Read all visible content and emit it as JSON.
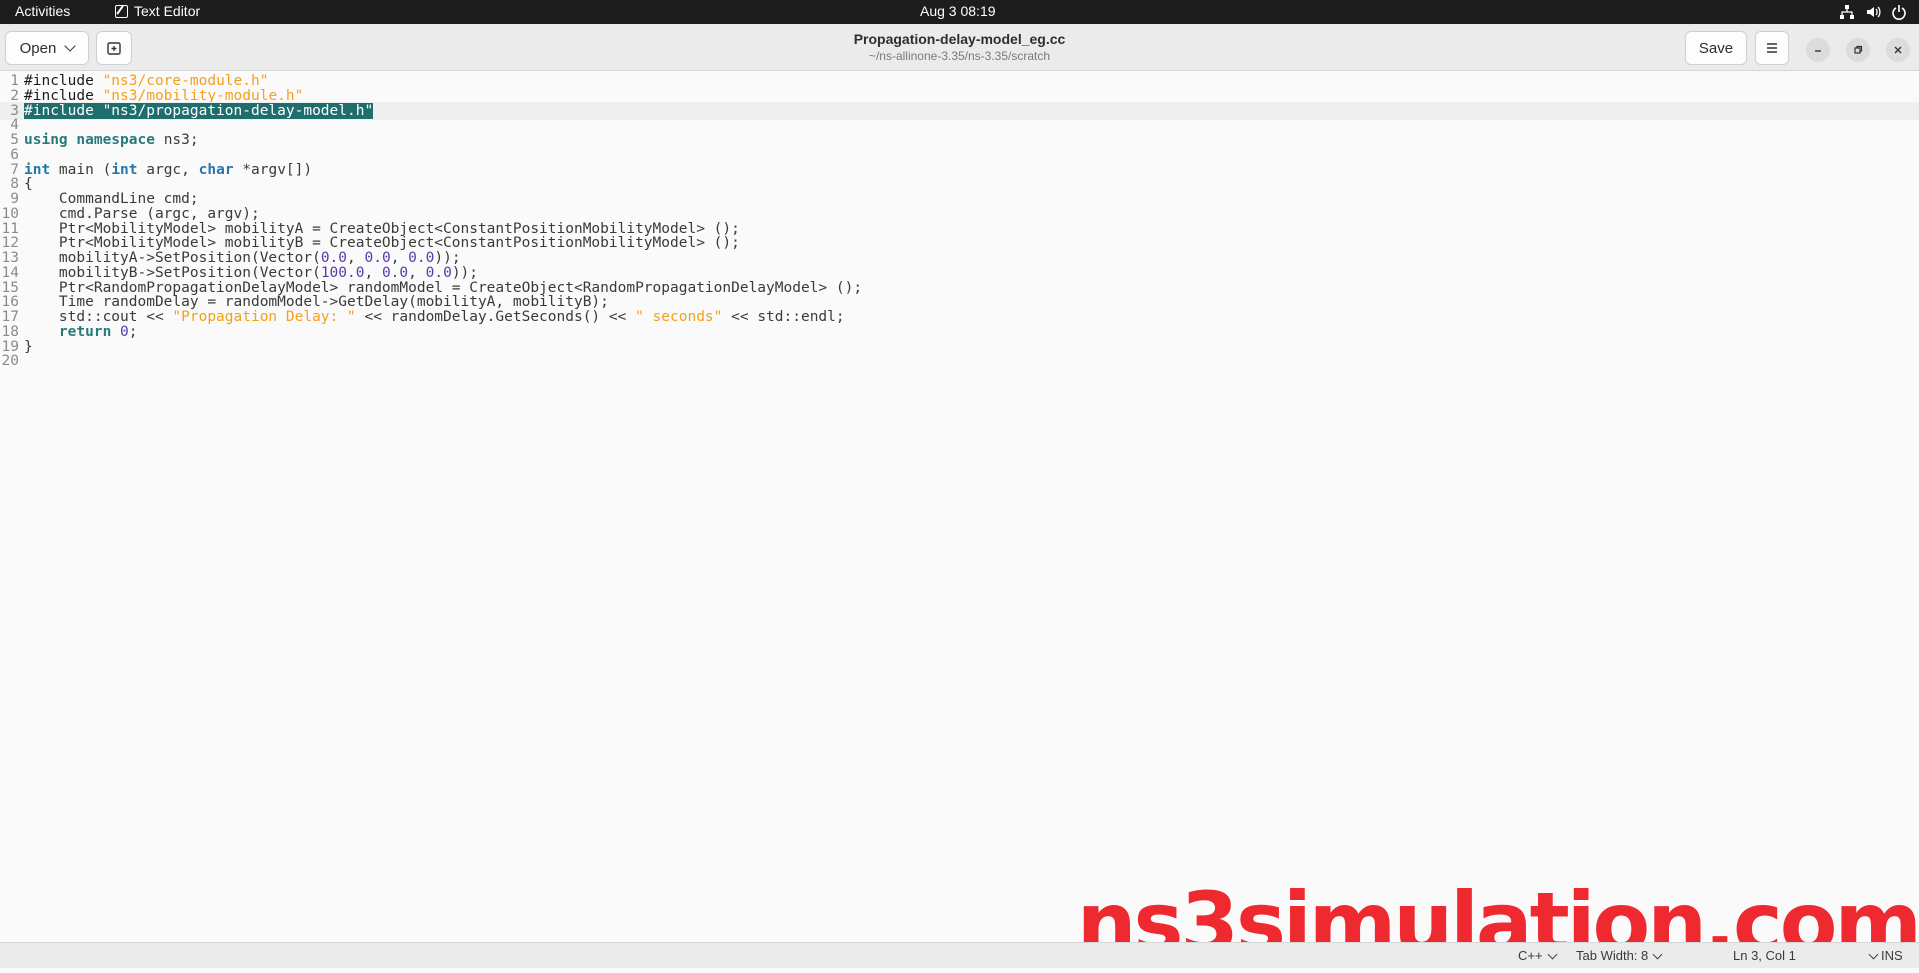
{
  "topbar": {
    "activities": "Activities",
    "app_name": "Text Editor",
    "clock": "Aug 3  08:19"
  },
  "header": {
    "open_label": "Open",
    "title": "Propagation-delay-model_eg.cc",
    "path": "~/ns-allinone-3.35/ns-3.35/scratch",
    "save_label": "Save"
  },
  "editor": {
    "lines": [
      {
        "n": "1",
        "text": "#include \"ns3/core-module.h\""
      },
      {
        "n": "2",
        "text": "#include \"ns3/mobility-module.h\""
      },
      {
        "n": "3",
        "text": "#include \"ns3/propagation-delay-model.h\""
      },
      {
        "n": "4",
        "text": ""
      },
      {
        "n": "5",
        "text": "using namespace ns3;"
      },
      {
        "n": "6",
        "text": ""
      },
      {
        "n": "7",
        "text": "int main (int argc, char *argv[])"
      },
      {
        "n": "8",
        "text": "{"
      },
      {
        "n": "9",
        "text": "    CommandLine cmd;"
      },
      {
        "n": "10",
        "text": "    cmd.Parse (argc, argv);"
      },
      {
        "n": "11",
        "text": "    Ptr<MobilityModel> mobilityA = CreateObject<ConstantPositionMobilityModel> ();"
      },
      {
        "n": "12",
        "text": "    Ptr<MobilityModel> mobilityB = CreateObject<ConstantPositionMobilityModel> ();"
      },
      {
        "n": "13",
        "text": "    mobilityA->SetPosition(Vector(0.0, 0.0, 0.0));"
      },
      {
        "n": "14",
        "text": "    mobilityB->SetPosition(Vector(100.0, 0.0, 0.0));"
      },
      {
        "n": "15",
        "text": "    Ptr<RandomPropagationDelayModel> randomModel = CreateObject<RandomPropagationDelayModel> ();"
      },
      {
        "n": "16",
        "text": "    Time randomDelay = randomModel->GetDelay(mobilityA, mobilityB);"
      },
      {
        "n": "17",
        "text": "    std::cout << \"Propagation Delay: \" << randomDelay.GetSeconds() << \" seconds\" << std::endl;"
      },
      {
        "n": "18",
        "text": "    return 0;"
      },
      {
        "n": "19",
        "text": "}"
      },
      {
        "n": "20",
        "text": ""
      }
    ],
    "current_line": 3
  },
  "watermark": "ns3simulation.com",
  "statusbar": {
    "language": "C++",
    "tab_width": "Tab Width: 8",
    "position": "Ln 3, Col 1",
    "mode": "INS"
  },
  "colors": {
    "keyword": "#2a7a7a",
    "type": "#2876a8",
    "string": "#f4a01c",
    "number": "#5a3aa8",
    "selection": "#1f6e6e",
    "watermark": "#ee2a30"
  }
}
